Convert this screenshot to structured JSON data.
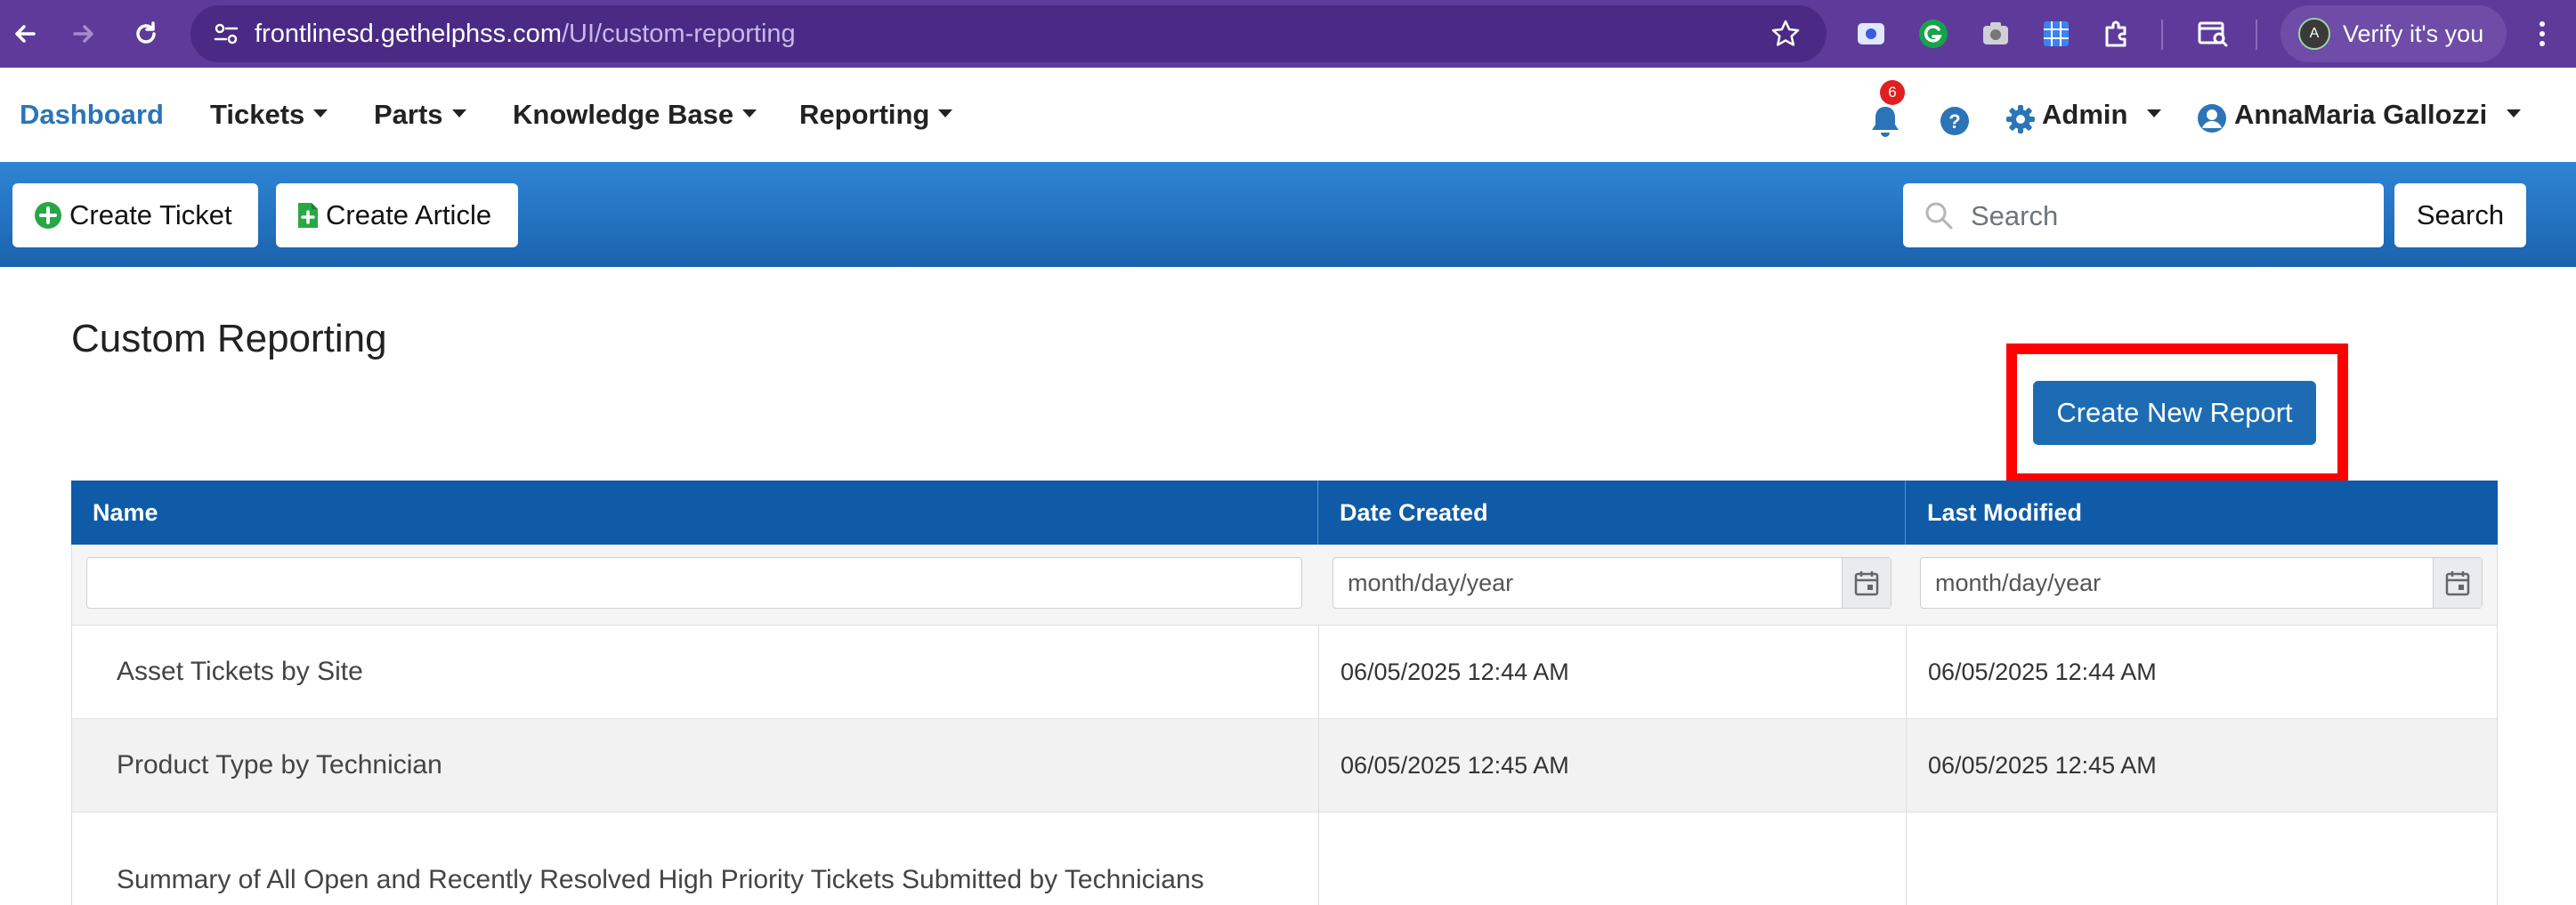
{
  "browser": {
    "url_domain": "frontlinesd.gethelphss.com",
    "url_path": "/UI/custom-reporting",
    "verify_label": "Verify it's you",
    "avatar_letter": "A"
  },
  "nav": {
    "dashboard": "Dashboard",
    "tickets": "Tickets",
    "parts": "Parts",
    "knowledge_base": "Knowledge Base",
    "reporting": "Reporting",
    "notification_count": "6",
    "admin": "Admin",
    "user": "AnnaMaria Gallozzi"
  },
  "toolbar": {
    "create_ticket": "Create Ticket",
    "create_article": "Create Article",
    "search_placeholder": "Search",
    "search_button": "Search"
  },
  "page": {
    "title": "Custom Reporting",
    "create_report_button": "Create New Report"
  },
  "table": {
    "headers": [
      "Name",
      "Date Created",
      "Last Modified"
    ],
    "date_placeholder": "month/day/year",
    "rows": [
      {
        "name": "Asset Tickets by Site",
        "created": "06/05/2025 12:44 AM",
        "modified": "06/05/2025 12:44 AM"
      },
      {
        "name": "Product Type by Technician",
        "created": "06/05/2025 12:45 AM",
        "modified": "06/05/2025 12:45 AM"
      },
      {
        "name": "Summary of All Open and Recently Resolved High Priority Tickets Submitted by Technicians",
        "created": "",
        "modified": ""
      }
    ]
  },
  "colors": {
    "browser_bar": "#5e3b9a",
    "nav_active": "#2c74b8",
    "toolbar": "#1a62ae",
    "table_header": "#0f5ba7",
    "primary_button": "#1d6cb3",
    "highlight": "#ff0000"
  },
  "icons": [
    "back-icon",
    "forward-icon",
    "reload-icon",
    "site-info-icon",
    "star-icon",
    "bell-icon",
    "help-icon",
    "gear-icon",
    "user-icon",
    "plus-circle-icon",
    "file-plus-icon",
    "search-icon",
    "calendar-icon"
  ]
}
